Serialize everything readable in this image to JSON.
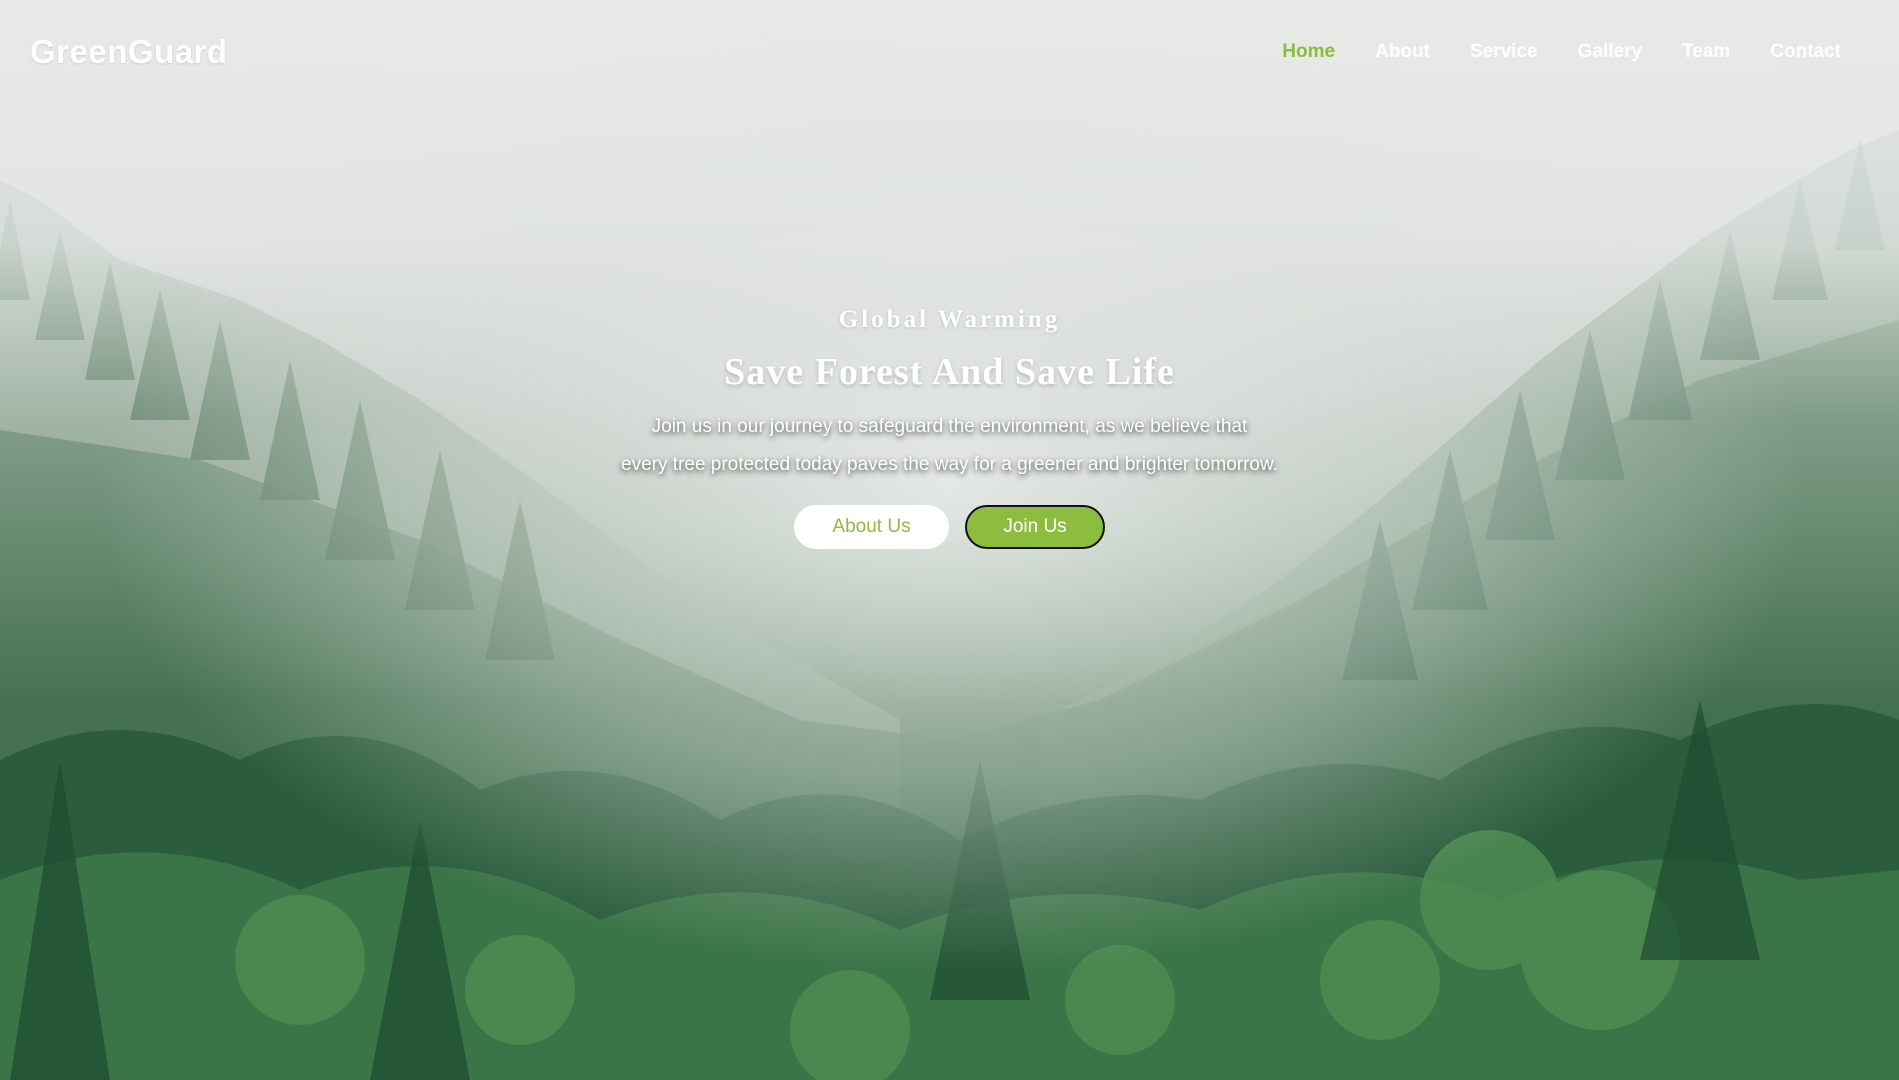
{
  "brand": {
    "name": "GreenGuard"
  },
  "nav": {
    "items": [
      {
        "label": "Home",
        "active": true
      },
      {
        "label": "About",
        "active": false
      },
      {
        "label": "Service",
        "active": false
      },
      {
        "label": "Gallery",
        "active": false
      },
      {
        "label": "Team",
        "active": false
      },
      {
        "label": "Contact",
        "active": false
      }
    ]
  },
  "hero": {
    "eyebrow": "Global Warming",
    "title": "Save Forest And Save Life",
    "text_line1": "Join us in our journey to safeguard the environment, as we believe that",
    "text_line2": "every tree protected today paves the way for a greener and brighter tomorrow.",
    "buttons": {
      "about": "About Us",
      "join": "Join Us"
    },
    "background": "misty-forest-image"
  },
  "colors": {
    "accent": "#8cbd3f",
    "text_light": "#ffffff",
    "forest_dark": "#265536",
    "fog": "#e4e6e4"
  }
}
